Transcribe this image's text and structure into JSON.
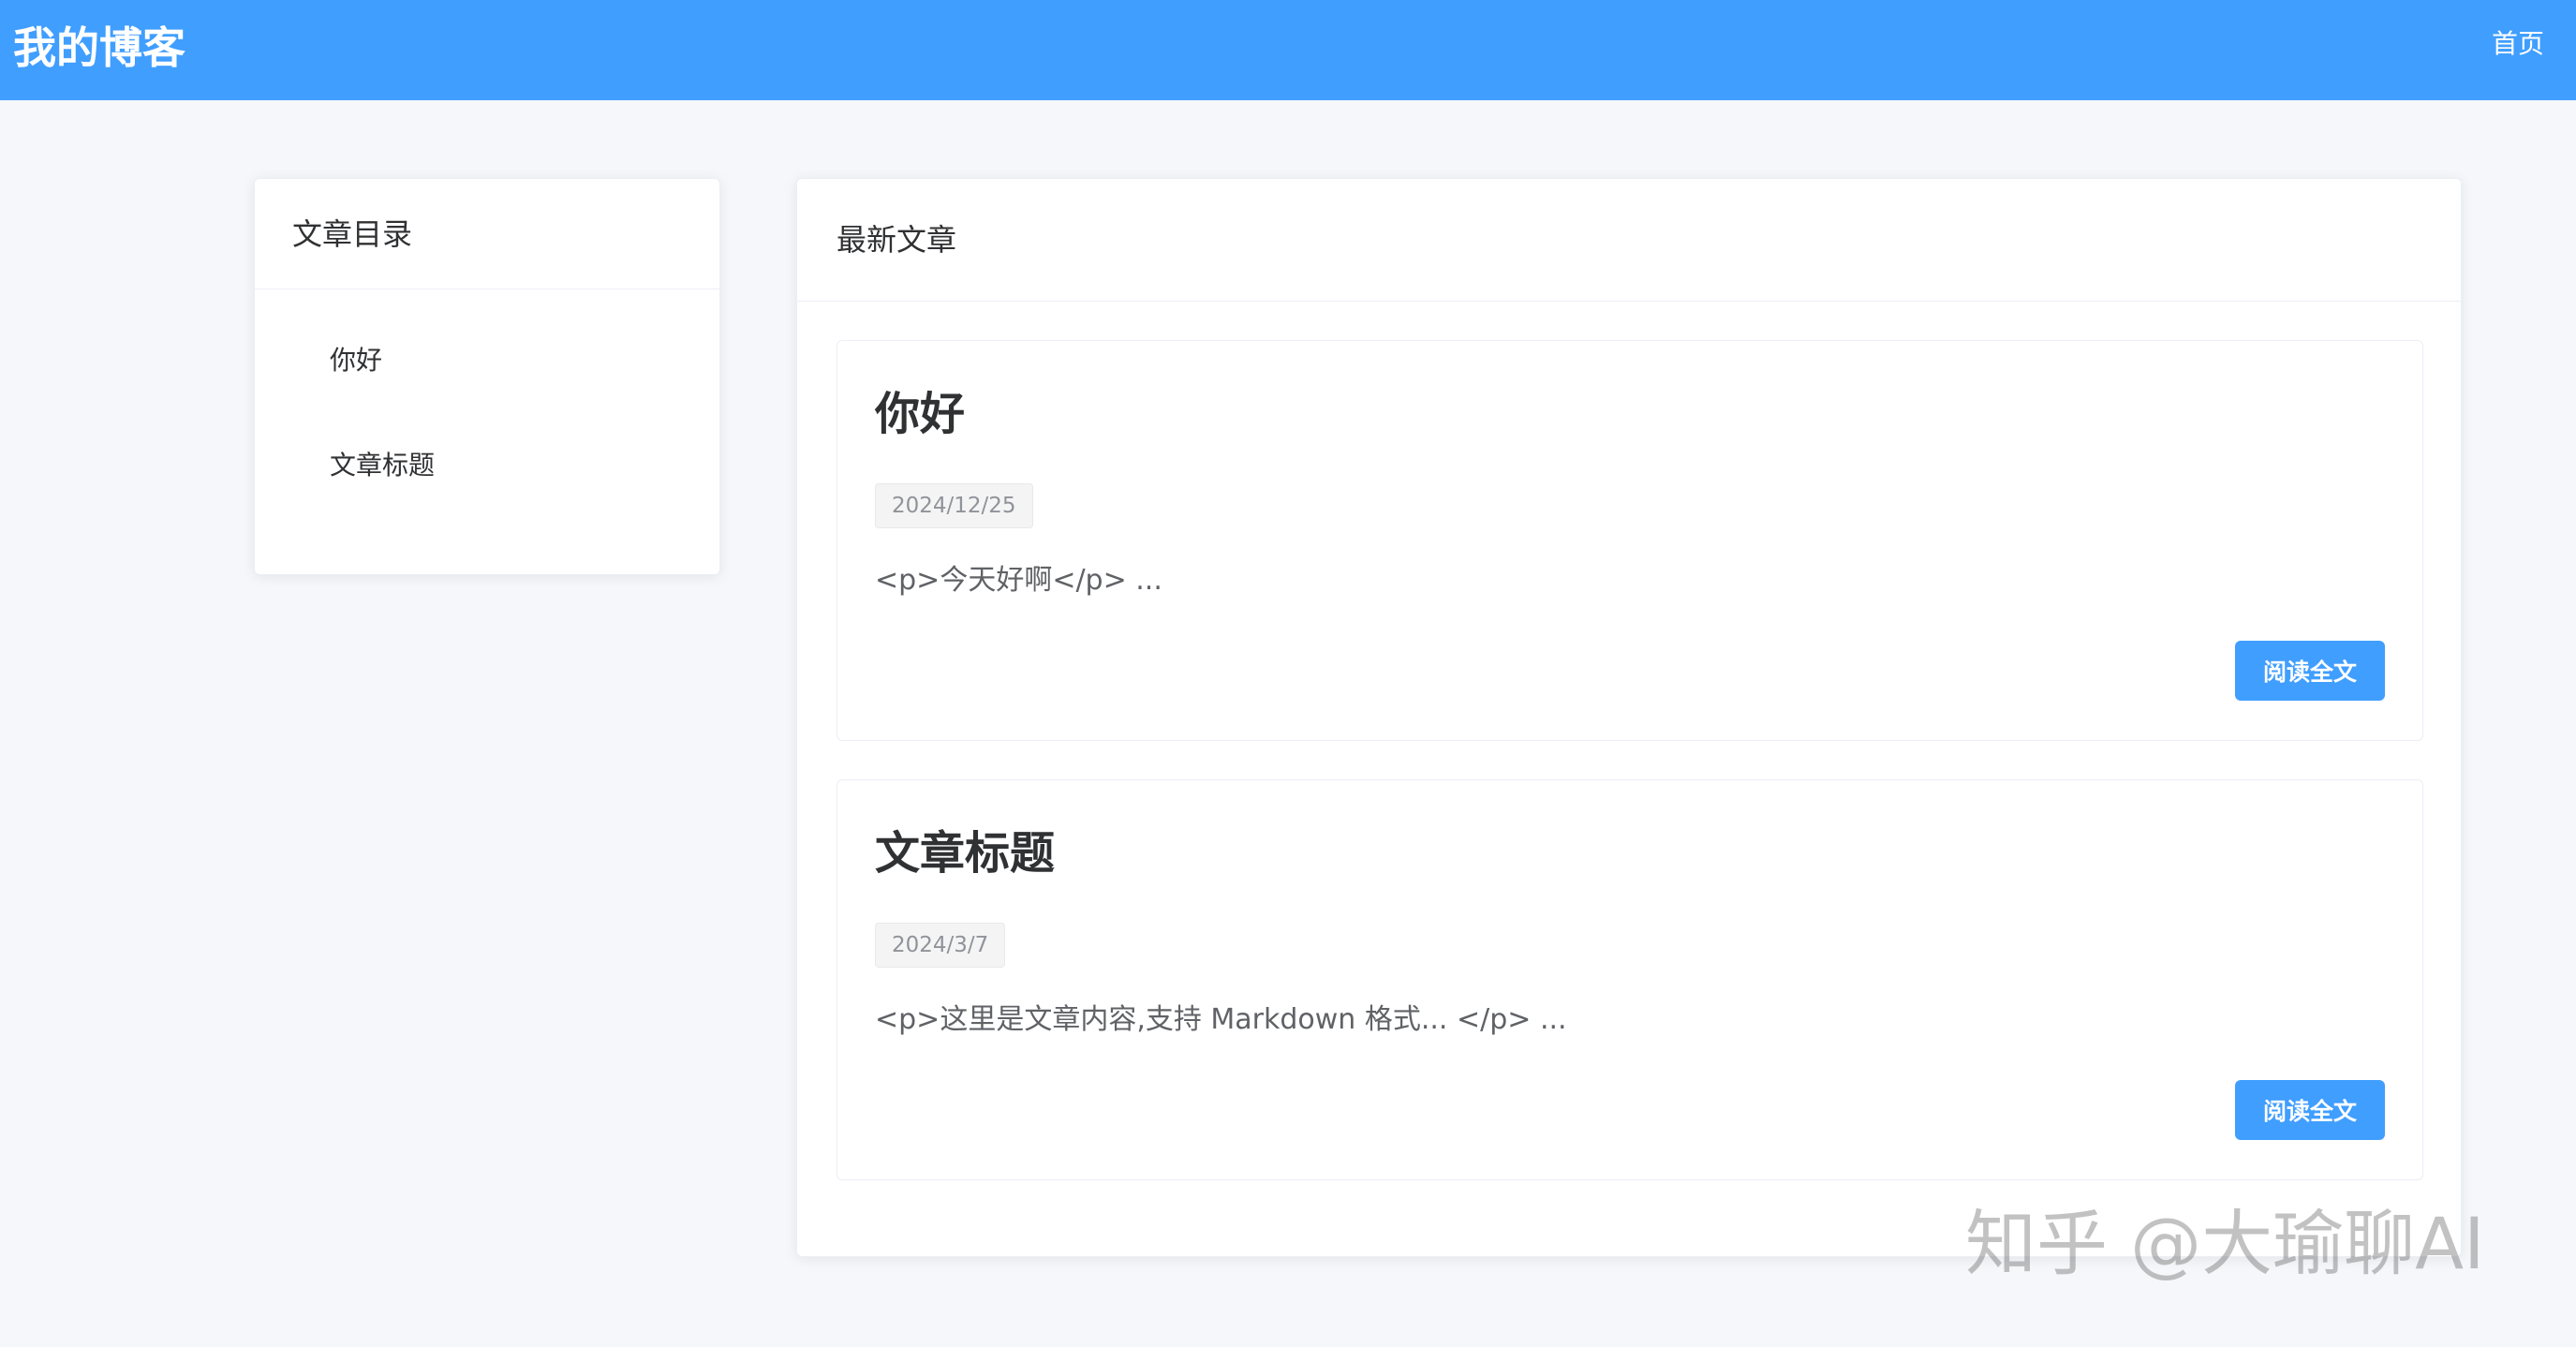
{
  "header": {
    "brand": "我的博客",
    "nav_home": "首页"
  },
  "sidebar": {
    "title": "文章目录",
    "items": [
      {
        "label": "你好"
      },
      {
        "label": "文章标题"
      }
    ]
  },
  "main": {
    "title": "最新文章",
    "articles": [
      {
        "title": "你好",
        "date": "2024/12/25",
        "excerpt": "<p>今天好啊</p> ...",
        "read_label": "阅读全文"
      },
      {
        "title": "文章标题",
        "date": "2024/3/7",
        "excerpt": "<p>这里是文章内容,支持 Markdown 格式... </p> ...",
        "read_label": "阅读全文"
      }
    ]
  },
  "watermark": "知乎 @大瑜聊AI",
  "colors": {
    "accent": "#409eff",
    "background": "#f5f7fa",
    "card": "#ffffff",
    "text": "#303133",
    "muted_text": "#909399"
  }
}
